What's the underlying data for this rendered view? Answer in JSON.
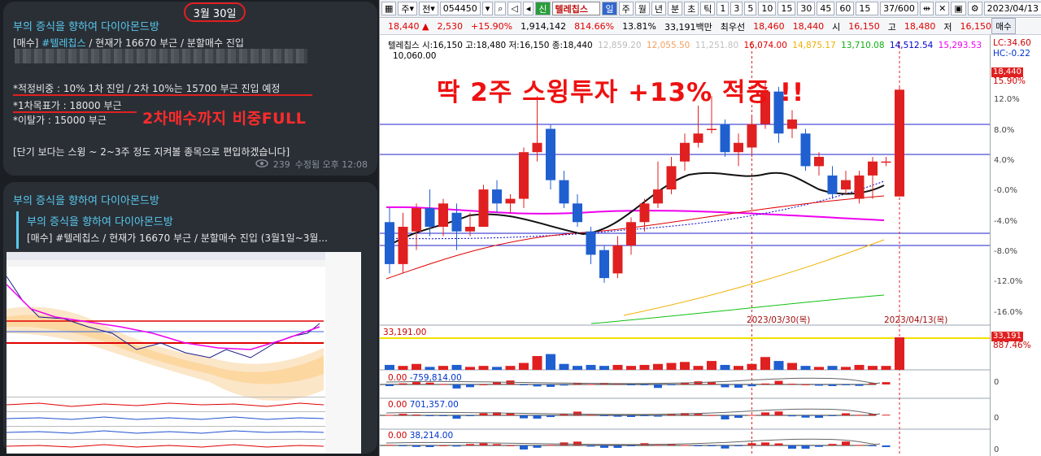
{
  "chat": {
    "date_pill": "3월 30일",
    "msg1": {
      "channel": "부의 증식을 향하여 다이아몬드방",
      "line1_tag": "[매수]",
      "line1_hash": "#텔레칩스",
      "line1_rest": " / 현재가 16670 부근 / 분할매수 진입",
      "line_weight": "*적정비중 : 10% 1차 진입 / 2차 10%는 15700 부근 진입 예정",
      "line_target": "*1차목표가 : 18000 부근",
      "line_stop": "*이탈가 : 15000 부근",
      "line_note": "[단기 보다는 스윙 ~ 2~3주 정도 지켜볼 종목으로 편입하겠습니다]",
      "views": "239",
      "edited": "수정됨 오후 12:08",
      "overlay_text": "2차매수까지 비중FULL"
    },
    "msg2": {
      "channel": "부의 증식을 향하여 다이아몬드방",
      "quote_channel": "부의 증식을 향하여 다이아몬드방",
      "quote_text": "[매수] #텔레칩스 / 현재가 16670 부근 / 분할매수 진입 (3월1일~3월..."
    }
  },
  "toolbar": {
    "code": "054450",
    "market_tag": "신",
    "stock_name": "텔레칩스",
    "periods": [
      "일",
      "주",
      "월",
      "년",
      "분",
      "초",
      "틱"
    ],
    "selected_period": "일",
    "intervals": [
      "1",
      "3",
      "5",
      "10",
      "15",
      "30",
      "45",
      "60"
    ],
    "interval_value": "15",
    "count": "37/600",
    "date": "2023/04/13",
    "prefix_1": "주",
    "prefix_2": "전"
  },
  "quote": {
    "price": "18,440 ▲",
    "change": "2,530",
    "change_pct": "+15.90%",
    "volume": "1,914,142",
    "vol_ratio": "814.66%",
    "turnover": "13.81%",
    "amount": "33,191백만",
    "best_label": "최우선",
    "best_price": "18,460",
    "best_price2": "18,440",
    "open_label": "시",
    "open": "16,150",
    "high_label": "고",
    "high": "18,480",
    "low_label": "저",
    "low": "16,150"
  },
  "legend": {
    "title": "텔레칩스 시:16,150 고:18,480 저:16,150 종:18,440",
    "ma": [
      "12,859.20",
      "12,055.50",
      "11,251.80",
      "16,074.00",
      "14,875.17",
      "13,710.08",
      "14,512.54",
      "15,293.53"
    ],
    "ma_colors": [
      "#bbbbbb",
      "#f0a060",
      "#c0c0c0",
      "#e00000",
      "#f0b000",
      "#10b010",
      "#0000cc",
      "#ee00ee"
    ],
    "extra": "10,060.00"
  },
  "headline": "딱 2주 스윙투자 +13% 적중 !!",
  "side": {
    "buy_button": "매수",
    "lc": "LC:34.60",
    "hc": "HC:-0.22",
    "last_price": "18,440",
    "last_pct": "15.90%",
    "vol_last": "33,191",
    "vol_pct": "887.46%",
    "axis": [
      "12.0%",
      "8.0%",
      "4.0%",
      "-0.0%",
      "-4.0%",
      "-8.0%",
      "-12.0%",
      "-16.0%"
    ],
    "zero": "0"
  },
  "panels": {
    "volume_label": "33,191.00",
    "p1_label": "0.00",
    "p1_value": "-759,814.00",
    "p2_label": "0.00",
    "p2_value": "701,357.00",
    "p3_label": "0.00",
    "p3_value": "38,214.00"
  },
  "markers": {
    "date1": "2023/03/30(목)",
    "date2": "2023/04/13(목)"
  },
  "chart_data": {
    "type": "candlestick",
    "title": "텔레칩스",
    "candles": [
      {
        "o": 15600,
        "c": 14700,
        "h": 15900,
        "l": 14500
      },
      {
        "o": 14700,
        "c": 15500,
        "h": 15800,
        "l": 14500
      },
      {
        "o": 15400,
        "c": 15900,
        "h": 16000,
        "l": 15000
      },
      {
        "o": 15900,
        "c": 15500,
        "h": 16300,
        "l": 15300
      },
      {
        "o": 15500,
        "c": 16000,
        "h": 16100,
        "l": 15300
      },
      {
        "o": 15800,
        "c": 15400,
        "h": 16000,
        "l": 15000
      },
      {
        "o": 15400,
        "c": 15500,
        "h": 15800,
        "l": 15300
      },
      {
        "o": 15500,
        "c": 16300,
        "h": 16400,
        "l": 15500
      },
      {
        "o": 16300,
        "c": 16000,
        "h": 16500,
        "l": 15800
      },
      {
        "o": 16000,
        "c": 16100,
        "h": 16200,
        "l": 15800
      },
      {
        "o": 16100,
        "c": 17100,
        "h": 17200,
        "l": 15900
      },
      {
        "o": 17100,
        "c": 17300,
        "h": 18300,
        "l": 16900
      },
      {
        "o": 17600,
        "c": 16500,
        "h": 17700,
        "l": 16300
      },
      {
        "o": 16500,
        "c": 16000,
        "h": 16700,
        "l": 15900
      },
      {
        "o": 16000,
        "c": 15600,
        "h": 16200,
        "l": 15500
      },
      {
        "o": 15400,
        "c": 14900,
        "h": 15500,
        "l": 14700
      },
      {
        "o": 15000,
        "c": 14400,
        "h": 15100,
        "l": 14300
      },
      {
        "o": 14500,
        "c": 15100,
        "h": 15300,
        "l": 14400
      },
      {
        "o": 15100,
        "c": 15600,
        "h": 15700,
        "l": 14900
      },
      {
        "o": 15600,
        "c": 16000,
        "h": 16100,
        "l": 15400
      },
      {
        "o": 16000,
        "c": 16300,
        "h": 16900,
        "l": 15900
      },
      {
        "o": 16300,
        "c": 16800,
        "h": 17000,
        "l": 16200
      },
      {
        "o": 16900,
        "c": 17300,
        "h": 17500,
        "l": 16700
      },
      {
        "o": 17300,
        "c": 17500,
        "h": 18100,
        "l": 17200
      },
      {
        "o": 17600,
        "c": 17600,
        "h": 18300,
        "l": 17500
      },
      {
        "o": 17700,
        "c": 17100,
        "h": 17800,
        "l": 17000
      },
      {
        "o": 17100,
        "c": 17300,
        "h": 17500,
        "l": 16800
      },
      {
        "o": 17200,
        "c": 17700,
        "h": 17900,
        "l": 17000
      },
      {
        "o": 17700,
        "c": 18400,
        "h": 18600,
        "l": 17600
      },
      {
        "o": 18400,
        "c": 17500,
        "h": 18500,
        "l": 17300
      },
      {
        "o": 17600,
        "c": 17800,
        "h": 18000,
        "l": 17400
      },
      {
        "o": 17500,
        "c": 16800,
        "h": 17600,
        "l": 16700
      },
      {
        "o": 16800,
        "c": 17000,
        "h": 17100,
        "l": 16600
      },
      {
        "o": 16600,
        "c": 16200,
        "h": 16800,
        "l": 16100
      },
      {
        "o": 16300,
        "c": 16500,
        "h": 16700,
        "l": 16200
      },
      {
        "o": 16100,
        "c": 16600,
        "h": 16700,
        "l": 16000
      },
      {
        "o": 16600,
        "c": 16900,
        "h": 17000,
        "l": 16100
      },
      {
        "o": 16900,
        "c": 16900,
        "h": 17000,
        "l": 16800
      },
      {
        "o": 16150,
        "c": 18440,
        "h": 18480,
        "l": 16150
      }
    ],
    "volume": [
      5,
      4,
      6,
      3,
      4,
      5,
      3,
      4,
      3,
      4,
      7,
      14,
      16,
      6,
      4,
      5,
      4,
      5,
      4,
      5,
      6,
      7,
      8,
      4,
      9,
      5,
      4,
      6,
      13,
      9,
      7,
      4,
      3,
      4,
      3,
      5,
      4,
      4,
      33
    ],
    "axis_pct": [
      "12.0%",
      "8.0%",
      "4.0%",
      "-0.0%",
      "-4.0%",
      "-8.0%",
      "-12.0%",
      "-16.0%"
    ]
  }
}
